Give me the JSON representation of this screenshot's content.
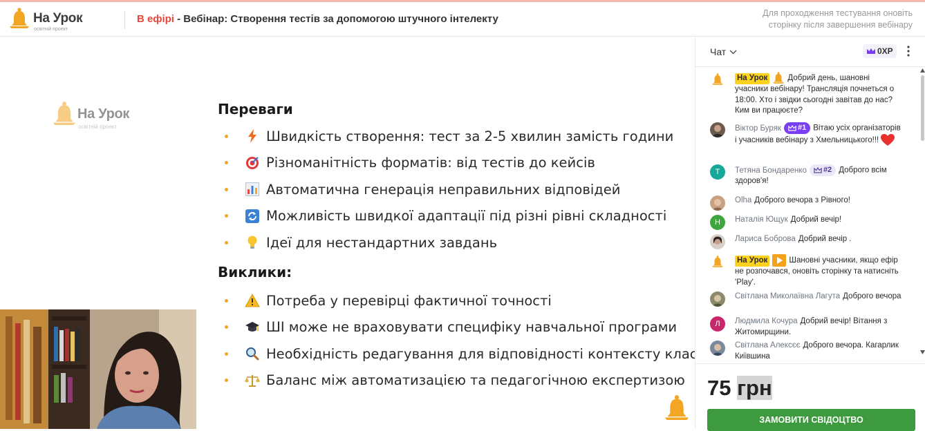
{
  "header": {
    "logo_name": "На Урок",
    "logo_sub": "освітній проект",
    "live_label": "В ефірі",
    "title": " - Вебінар: Створення тестів за допомогою штучного інтелекту",
    "note": "Для проходження тестування оновіть сторінку після завершення вебінару"
  },
  "slide": {
    "logo_name": "На Урок",
    "logo_sub": "освітній проект",
    "section1_title": "Переваги",
    "section1_items": [
      {
        "icon": "lightning-icon",
        "text": "Швидкість створення: тест за 2-5 хвилин замість години"
      },
      {
        "icon": "target-icon",
        "text": "Різноманітність форматів: від тестів до кейсів"
      },
      {
        "icon": "bar-chart-icon",
        "text": "Автоматична генерація неправильних відповідей"
      },
      {
        "icon": "refresh-icon",
        "text": "Можливість швидкої адаптації під різні рівні складності"
      },
      {
        "icon": "lightbulb-icon",
        "text": "Ідеї для нестандартних завдань"
      }
    ],
    "section2_title": "Виклики:",
    "section2_items": [
      {
        "icon": "warning-icon",
        "text": "Потреба у перевірці фактичної точності"
      },
      {
        "icon": "graduation-cap-icon",
        "text": "ШІ може не враховувати специфіку навчальної програми"
      },
      {
        "icon": "magnifier-icon",
        "text": "Необхідність редагування для відповідності контексту класу"
      },
      {
        "icon": "scales-icon",
        "text": "Баланс між автоматизацією та педагогічною експертизою"
      }
    ]
  },
  "chat": {
    "tab_label": "Чат",
    "xp": "0XP",
    "messages": [
      {
        "tag": "На Урок",
        "author": "",
        "rank": "",
        "text": "Добрий день, шановні учасники вебінару! Трансляція почнеться о 18:00. Хто і звідки сьогодні завітав до нас? Ким ви працюєте?"
      },
      {
        "tag": "",
        "author": "Віктор Буряк",
        "rank": "#1",
        "text": "Вітаю усіх організаторів і учасників вебінару з Хмельницького!!!"
      },
      {
        "tag": "",
        "author": "Тетяна Бондаренко",
        "rank": "#2",
        "text": "Доброго всім здоров'я!",
        "initial": "Т"
      },
      {
        "tag": "",
        "author": "Olha",
        "rank": "",
        "text": "Доброго вечора з Рівного!"
      },
      {
        "tag": "",
        "author": "Наталія Ющук",
        "rank": "",
        "text": "Добрий вечір!",
        "initial": "Н"
      },
      {
        "tag": "",
        "author": "Лариса Боброва",
        "rank": "",
        "text": "Добрий вечір ."
      },
      {
        "tag": "На Урок",
        "author": "",
        "rank": "",
        "text": "Шановні учасники, якщо ефір не розпочався, оновіть сторінку та натисніть 'Play'."
      },
      {
        "tag": "",
        "author": "Світлана Миколаївна Лагута",
        "rank": "",
        "text": "Доброго вечора"
      },
      {
        "tag": "",
        "author": "Людмила Кочура",
        "rank": "",
        "text": "Добрий вечір! Вітання з Житомирщини.",
        "initial": "Л"
      },
      {
        "tag": "",
        "author": "Світлана Алексєє",
        "rank": "",
        "text": "Доброго вечора. Кагарлик Київшина"
      }
    ]
  },
  "price": {
    "amount": "75 ",
    "currency": "грн"
  },
  "order_button": "ЗАМОВИТИ СВІДОЦТВО",
  "colors": {
    "accent_orange": "#f2a623",
    "live_red": "#e5473b",
    "button_green": "#3e9a3e",
    "tag_yellow": "#ffd21f",
    "rank_purple": "#7a3ff2"
  }
}
